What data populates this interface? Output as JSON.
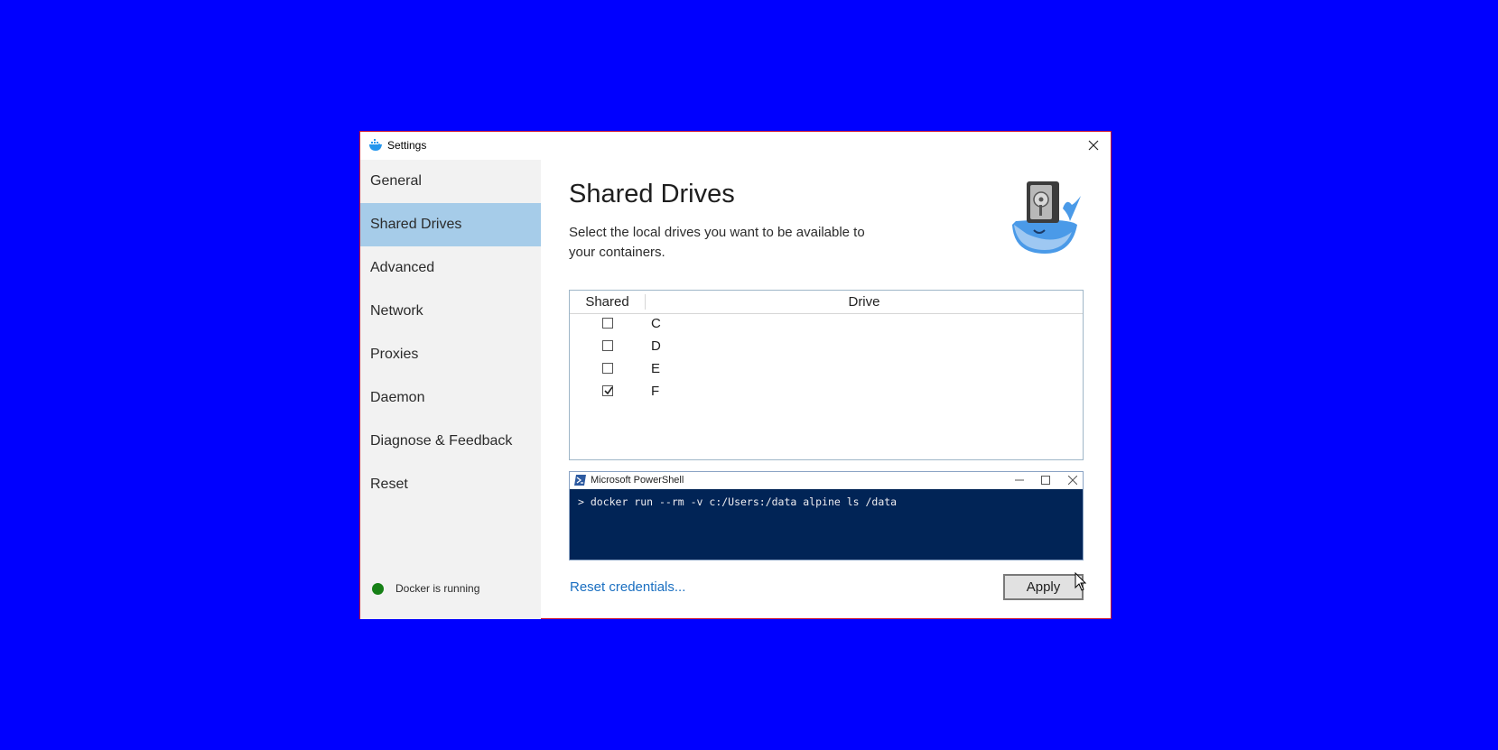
{
  "window": {
    "title": "Settings",
    "app_icon": "docker-whale-icon",
    "close_icon": "close-icon"
  },
  "sidebar": {
    "items": [
      {
        "label": "General",
        "active": false
      },
      {
        "label": "Shared Drives",
        "active": true
      },
      {
        "label": "Advanced",
        "active": false
      },
      {
        "label": "Network",
        "active": false
      },
      {
        "label": "Proxies",
        "active": false
      },
      {
        "label": "Daemon",
        "active": false
      },
      {
        "label": "Diagnose & Feedback",
        "active": false
      },
      {
        "label": "Reset",
        "active": false
      }
    ],
    "status": {
      "text": "Docker is running",
      "color": "#168016"
    }
  },
  "main": {
    "title": "Shared Drives",
    "description": "Select the local drives you want to be available to your containers.",
    "mascot": "docker-whale-drive-icon",
    "table": {
      "columns": [
        "Shared",
        "Drive"
      ],
      "rows": [
        {
          "drive": "C",
          "shared": false
        },
        {
          "drive": "D",
          "shared": false
        },
        {
          "drive": "E",
          "shared": false
        },
        {
          "drive": "F",
          "shared": true
        }
      ]
    },
    "powershell": {
      "title": "Microsoft PowerShell",
      "command": "> docker run --rm -v c:/Users:/data alpine ls /data",
      "background": "#012456"
    },
    "reset_link": "Reset credentials...",
    "apply_label": "Apply"
  },
  "colors": {
    "desktop": "#0000ff",
    "active_nav": "#a6cce9",
    "link": "#1a6fc1",
    "window_border": "#c8102e"
  }
}
